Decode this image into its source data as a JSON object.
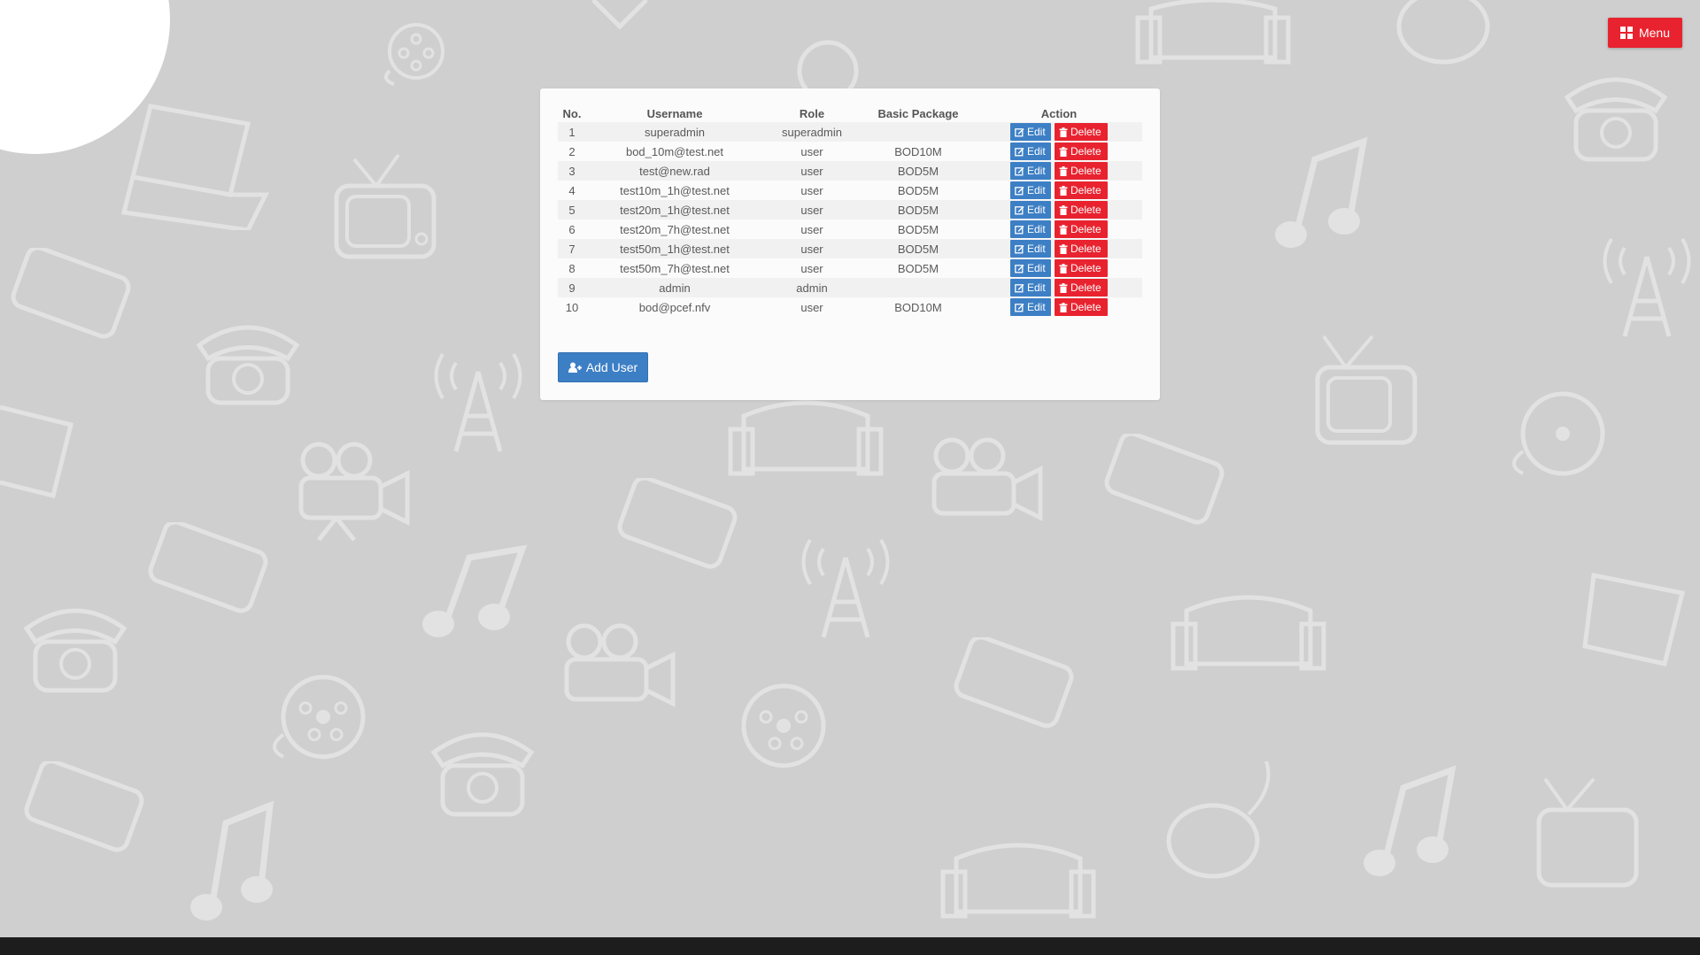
{
  "menu": {
    "label": "Menu",
    "icon": "grid-icon",
    "color": "#e8232f"
  },
  "table": {
    "headers": [
      "No.",
      "Username",
      "Role",
      "Basic Package",
      "Action"
    ],
    "rows": [
      {
        "no": "1",
        "username": "superadmin",
        "role": "superadmin",
        "package": ""
      },
      {
        "no": "2",
        "username": "bod_10m@test.net",
        "role": "user",
        "package": "BOD10M"
      },
      {
        "no": "3",
        "username": "test@new.rad",
        "role": "user",
        "package": "BOD5M"
      },
      {
        "no": "4",
        "username": "test10m_1h@test.net",
        "role": "user",
        "package": "BOD5M"
      },
      {
        "no": "5",
        "username": "test20m_1h@test.net",
        "role": "user",
        "package": "BOD5M"
      },
      {
        "no": "6",
        "username": "test20m_7h@test.net",
        "role": "user",
        "package": "BOD5M"
      },
      {
        "no": "7",
        "username": "test50m_1h@test.net",
        "role": "user",
        "package": "BOD5M"
      },
      {
        "no": "8",
        "username": "test50m_7h@test.net",
        "role": "user",
        "package": "BOD5M"
      },
      {
        "no": "9",
        "username": "admin",
        "role": "admin",
        "package": ""
      },
      {
        "no": "10",
        "username": "bod@pcef.nfv",
        "role": "user",
        "package": "BOD10M"
      }
    ],
    "edit_label": "Edit",
    "delete_label": "Delete"
  },
  "add_user": {
    "label": "Add User",
    "icon": "user-plus-icon"
  },
  "colors": {
    "primary": "#3d7fc5",
    "danger": "#e8232f",
    "background": "#cfcfcf",
    "panel": "#fbfbfb",
    "footer": "#1d1d1d"
  }
}
